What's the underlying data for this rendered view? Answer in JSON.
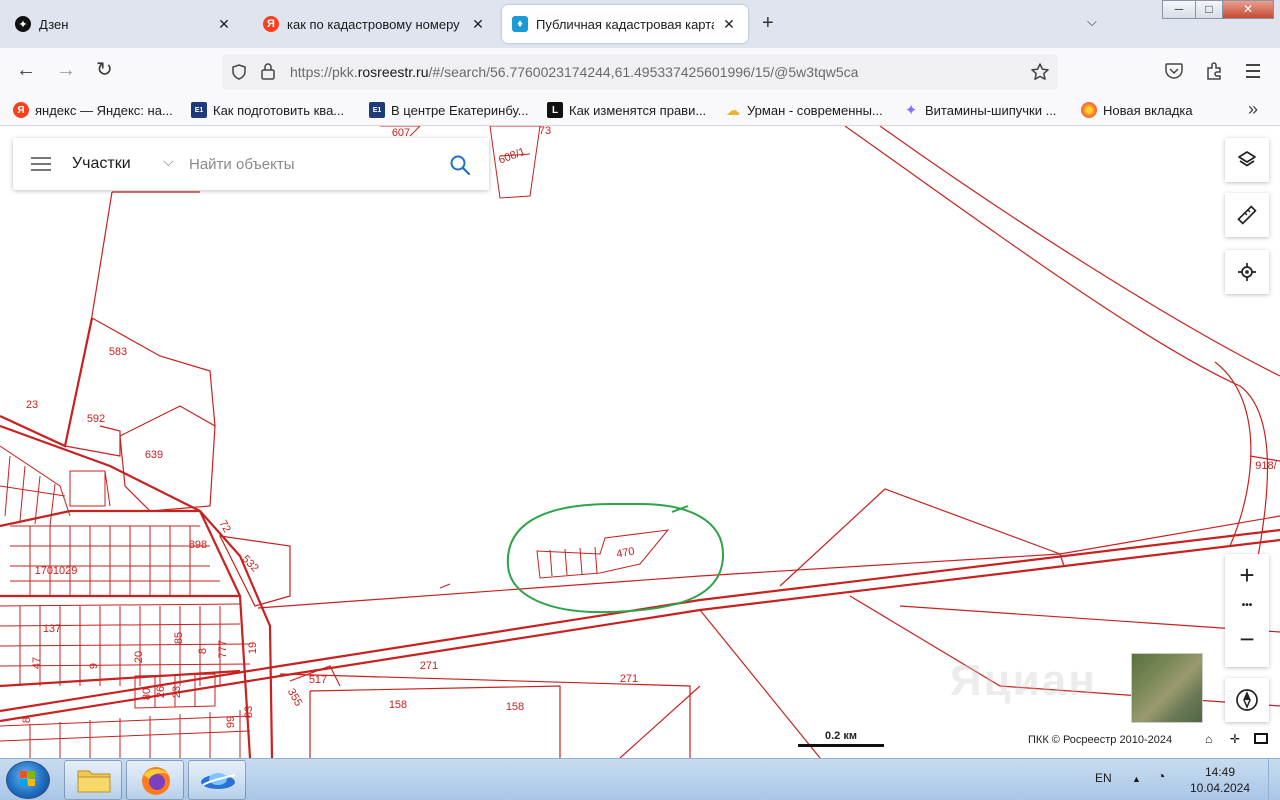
{
  "window": {
    "controls": {
      "minimize": "─",
      "maximize": "□",
      "close": "✕"
    }
  },
  "tabs": [
    {
      "title": "Дзен",
      "icon": "dzen-icon",
      "active": false
    },
    {
      "title": "как по кадастровому номеру у",
      "icon": "yandex-icon",
      "active": false
    },
    {
      "title": "Публичная кадастровая карта",
      "icon": "rosreestr-icon",
      "active": true
    }
  ],
  "tabbar": {
    "new_tab": "+",
    "tab_list": "⌵"
  },
  "url": {
    "prefix": "https://pkk.",
    "domain": "rosreestr.ru",
    "path": "/#/search/56.7760023174244,61.495337425601996/15/@5w3tqw5ca"
  },
  "bookmarks": [
    {
      "label": "яндекс — Яндекс: на...",
      "icon": "yandex-icon",
      "color": "#fc3f1d",
      "glyph": "Я"
    },
    {
      "label": "Как подготовить ква...",
      "icon": "e1-icon",
      "color": "#1e3a78",
      "glyph": "E1"
    },
    {
      "label": "В центре Екатеринбу...",
      "icon": "e1-icon",
      "color": "#1e3a78",
      "glyph": "E1"
    },
    {
      "label": "Как изменятся прави...",
      "icon": "l-icon",
      "color": "#111111",
      "glyph": "L"
    },
    {
      "label": "Урман - современны...",
      "icon": "cloud-icon",
      "color": "#f2c14e",
      "glyph": "☁"
    },
    {
      "label": "Витамины-шипучки ...",
      "icon": "sparkle-icon",
      "color": "#8a6bff",
      "glyph": "✦"
    },
    {
      "label": "Новая вкладка",
      "icon": "firefox-icon",
      "color": "#ff7a1a",
      "glyph": "●"
    }
  ],
  "search": {
    "type_label": "Участки",
    "placeholder": "Найти объекты"
  },
  "map": {
    "parcel_labels": [
      {
        "text": "607",
        "rot": -20
      },
      {
        "text": "608/1",
        "rot": -20
      },
      {
        "text": "73",
        "rot": -20
      },
      {
        "text": "583",
        "rot": 0
      },
      {
        "text": "23",
        "rot": 0
      },
      {
        "text": "592",
        "rot": 0
      },
      {
        "text": "639",
        "rot": 0
      },
      {
        "text": "898",
        "rot": 0
      },
      {
        "text": "72",
        "rot": 60
      },
      {
        "text": "532",
        "rot": 45
      },
      {
        "text": "1701029",
        "rot": 0
      },
      {
        "text": "137",
        "rot": 0
      },
      {
        "text": "85",
        "rot": -90
      },
      {
        "text": "8",
        "rot": -90
      },
      {
        "text": "777",
        "rot": -90
      },
      {
        "text": "19",
        "rot": -90
      },
      {
        "text": "47",
        "rot": -90
      },
      {
        "text": "9",
        "rot": -90
      },
      {
        "text": "20",
        "rot": -90
      },
      {
        "text": "80",
        "rot": -90
      },
      {
        "text": "26",
        "rot": -90
      },
      {
        "text": "23",
        "rot": -90
      },
      {
        "text": "8",
        "rot": -90
      },
      {
        "text": "99",
        "rot": -90
      },
      {
        "text": "83",
        "rot": -90
      },
      {
        "text": "355",
        "rot": 60
      },
      {
        "text": "517",
        "rot": 0
      },
      {
        "text": "271",
        "rot": 0
      },
      {
        "text": "271",
        "rot": 0
      },
      {
        "text": "158",
        "rot": 0
      },
      {
        "text": "158",
        "rot": 0
      },
      {
        "text": "470",
        "rot": -10
      },
      {
        "text": "918/",
        "rot": 0
      }
    ],
    "scale_label": "0.2 км",
    "copyright": "ПКК © Росреестр 2010-2024",
    "watermark": "Яциан",
    "colors": {
      "parcel": "#c8211f",
      "highlight": "#2ea34a"
    }
  },
  "map_controls": {
    "layers": "layers-icon",
    "ruler": "ruler-icon",
    "locate": "locate-icon",
    "zoom_in": "+",
    "more": "•••",
    "zoom_out": "−",
    "compass": "compass-icon"
  },
  "taskbar": {
    "language": "EN",
    "time": "14:49",
    "date": "10.04.2024"
  }
}
